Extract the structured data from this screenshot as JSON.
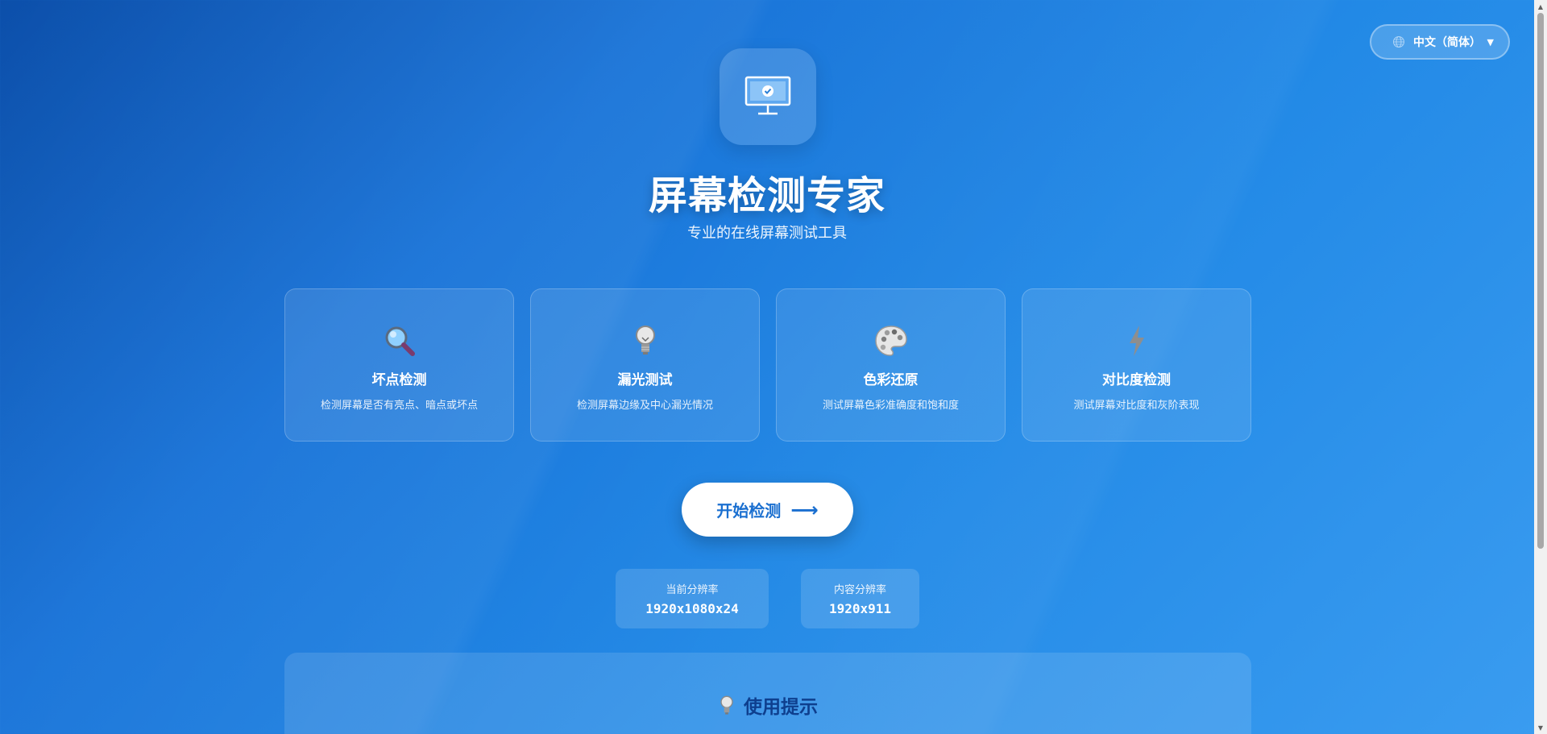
{
  "language_selector": {
    "label": "中文（简体）",
    "icon": "globe-icon",
    "caret": "▼"
  },
  "header": {
    "logo_icon": "monitor-check-icon",
    "title": "屏幕检测专家",
    "subtitle": "专业的在线屏幕测试工具"
  },
  "features": [
    {
      "icon": "magnifier-icon",
      "title": "坏点检测",
      "description": "检测屏幕是否有亮点、暗点或坏点"
    },
    {
      "icon": "lightbulb-icon",
      "title": "漏光测试",
      "description": "检测屏幕边缘及中心漏光情况"
    },
    {
      "icon": "palette-icon",
      "title": "色彩还原",
      "description": "测试屏幕色彩准确度和饱和度"
    },
    {
      "icon": "lightning-icon",
      "title": "对比度检测",
      "description": "测试屏幕对比度和灰阶表现"
    }
  ],
  "start_button": {
    "label": "开始检测",
    "arrow": "⟶"
  },
  "resolution": {
    "current_label": "当前分辨率",
    "current_value": "1920x1080x24",
    "content_label": "内容分辨率",
    "content_value": "1920x911"
  },
  "tips": {
    "icon": "lightbulb-icon",
    "title": "使用提示"
  },
  "colors": {
    "background_start": "#0c4faa",
    "background_end": "#3a9cf0",
    "button_text": "#1a6fd0",
    "tips_title": "#0e3f8e"
  }
}
